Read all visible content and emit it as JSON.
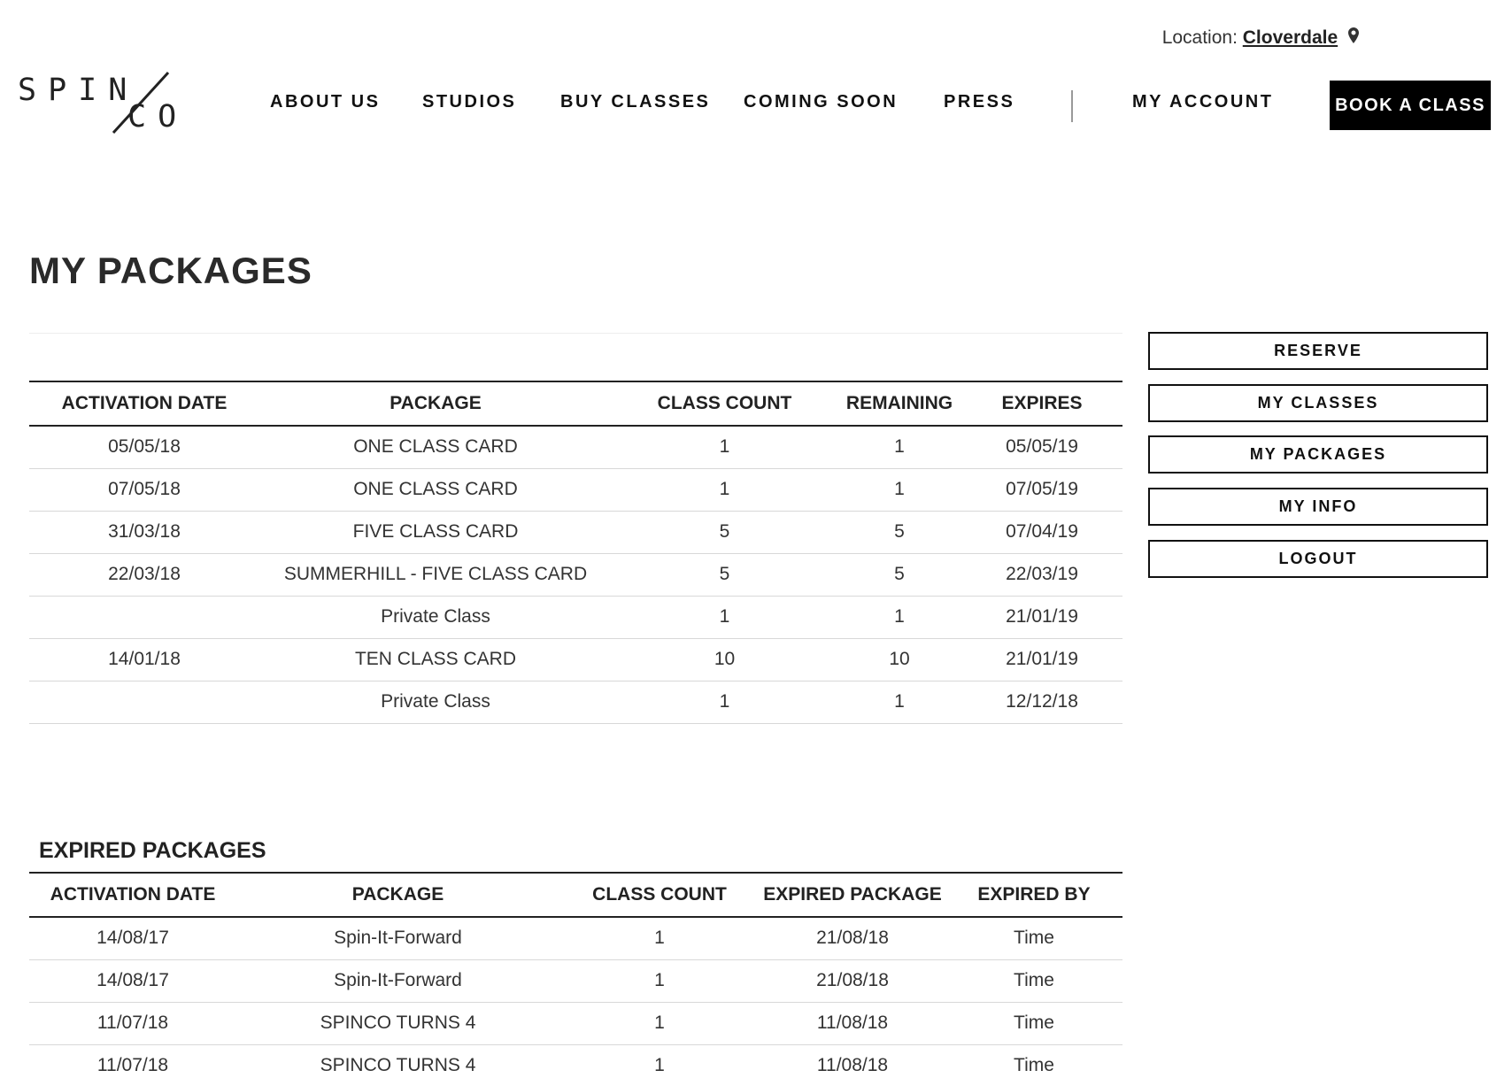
{
  "header": {
    "location_label": "Location:",
    "location_value": "Cloverdale",
    "logo_top": "SPIN",
    "logo_bottom": "CO",
    "nav": [
      {
        "label": "ABOUT US"
      },
      {
        "label": "STUDIOS"
      },
      {
        "label": "BUY CLASSES"
      },
      {
        "label": "COMING SOON"
      },
      {
        "label": "PRESS"
      },
      {
        "label": "MY ACCOUNT"
      }
    ],
    "book_label": "BOOK A CLASS"
  },
  "page_title": "MY PACKAGES",
  "packages": {
    "columns": [
      "ACTIVATION DATE",
      "PACKAGE",
      "CLASS COUNT",
      "REMAINING",
      "EXPIRES"
    ],
    "rows": [
      [
        "05/05/18",
        "ONE CLASS CARD",
        "1",
        "1",
        "05/05/19"
      ],
      [
        "07/05/18",
        "ONE CLASS CARD",
        "1",
        "1",
        "07/05/19"
      ],
      [
        "31/03/18",
        "FIVE CLASS CARD",
        "5",
        "5",
        "07/04/19"
      ],
      [
        "22/03/18",
        "SUMMERHILL - FIVE CLASS CARD",
        "5",
        "5",
        "22/03/19"
      ],
      [
        "",
        "Private Class",
        "1",
        "1",
        "21/01/19"
      ],
      [
        "14/01/18",
        "TEN CLASS CARD",
        "10",
        "10",
        "21/01/19"
      ],
      [
        "",
        "Private Class",
        "1",
        "1",
        "12/12/18"
      ]
    ]
  },
  "expired": {
    "title": "EXPIRED PACKAGES",
    "columns": [
      "ACTIVATION DATE",
      "PACKAGE",
      "CLASS COUNT",
      "EXPIRED PACKAGE",
      "EXPIRED BY"
    ],
    "rows": [
      [
        "14/08/17",
        "Spin-It-Forward",
        "1",
        "21/08/18",
        "Time"
      ],
      [
        "14/08/17",
        "Spin-It-Forward",
        "1",
        "21/08/18",
        "Time"
      ],
      [
        "11/07/18",
        "SPINCO TURNS 4",
        "1",
        "11/08/18",
        "Time"
      ],
      [
        "11/07/18",
        "SPINCO TURNS 4",
        "1",
        "11/08/18",
        "Time"
      ]
    ]
  },
  "sidebar": {
    "buttons": [
      {
        "label": "RESERVE"
      },
      {
        "label": "MY CLASSES"
      },
      {
        "label": "MY PACKAGES"
      },
      {
        "label": "MY INFO"
      },
      {
        "label": "LOGOUT"
      }
    ]
  }
}
